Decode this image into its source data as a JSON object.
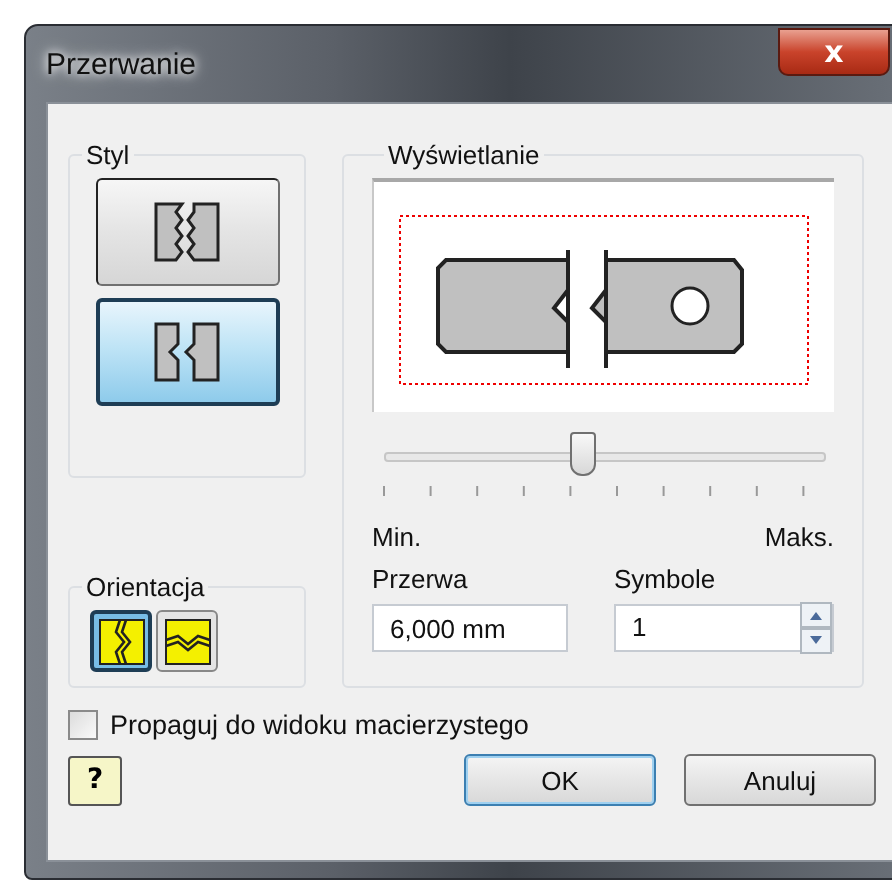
{
  "window": {
    "title": "Przerwanie",
    "close": "x"
  },
  "style_group": {
    "label": "Styl",
    "options": [
      {
        "kind": "rectangular",
        "selected": false
      },
      {
        "kind": "structural",
        "selected": true
      }
    ]
  },
  "display_group": {
    "label": "Wyświetlanie",
    "slider": {
      "level": 0.45
    },
    "min_label": "Min.",
    "max_label": "Maks.",
    "gap": {
      "label": "Przerwa",
      "value": "6,000 mm"
    },
    "symbols": {
      "label": "Symbole",
      "value": "1"
    }
  },
  "orientation_group": {
    "label": "Orientacja",
    "options": [
      {
        "kind": "horizontal",
        "selected": true
      },
      {
        "kind": "vertical",
        "selected": false
      }
    ]
  },
  "propagate": {
    "label": "Propaguj do widoku macierzystego",
    "checked": false
  },
  "buttons": {
    "help": "?",
    "ok": "OK",
    "cancel": "Anuluj"
  }
}
